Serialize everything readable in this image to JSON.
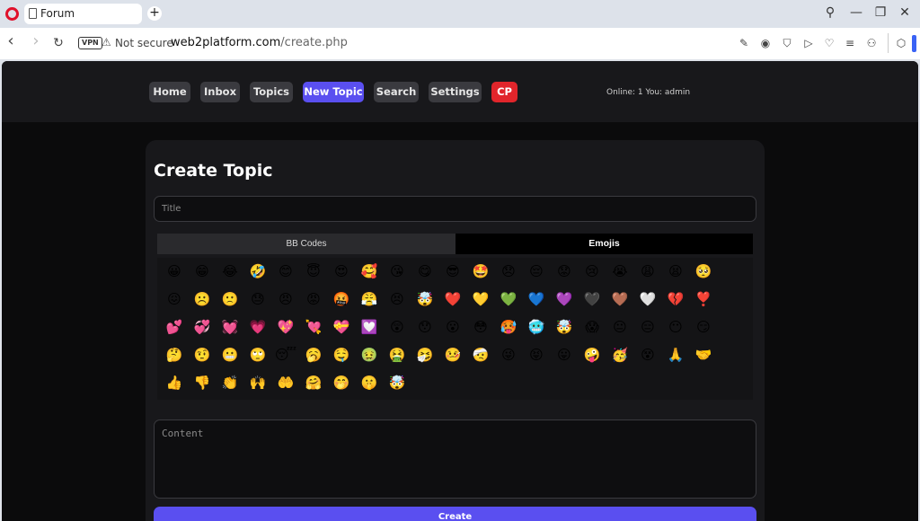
{
  "browser": {
    "tab_title": "Forum",
    "new_tab": "+",
    "controls": {
      "search": "⚲",
      "minimize": "—",
      "restore": "❐",
      "close": "✕"
    },
    "nav": {
      "back": "‹",
      "forward": "›",
      "reload": "↻"
    },
    "vpn_label": "VPN",
    "security_label": "Not secure",
    "url_host": "web2platform.com",
    "url_path": "/create.php",
    "toolbar_icons": [
      "edit-icon",
      "camera-icon",
      "shield-icon",
      "play-icon",
      "heart-icon",
      "menu-icon",
      "user-icon",
      "cube-icon"
    ]
  },
  "header": {
    "nav": [
      {
        "label": "Home",
        "state": "normal"
      },
      {
        "label": "Inbox",
        "state": "normal"
      },
      {
        "label": "Topics",
        "state": "normal"
      },
      {
        "label": "New Topic",
        "state": "active"
      },
      {
        "label": "Search",
        "state": "normal"
      },
      {
        "label": "Settings",
        "state": "normal"
      },
      {
        "label": "CP",
        "state": "danger"
      }
    ],
    "online_text": "Online: 1 You: admin"
  },
  "form": {
    "heading": "Create Topic",
    "title_placeholder": "Title",
    "tabs": {
      "bbcodes": "BB Codes",
      "emojis": "Emojis"
    },
    "emojis": [
      "😀",
      "😁",
      "😂",
      "🤣",
      "😊",
      "😇",
      "😍",
      "🥰",
      "😘",
      "😋",
      "😎",
      "🤩",
      "😞",
      "😔",
      "😟",
      "😢",
      "😭",
      "😩",
      "😫",
      "🥺",
      "😖",
      "☹️",
      "🙁",
      "😓",
      "😠",
      "😡",
      "🤬",
      "😤",
      "😣",
      "🤯",
      "❤️",
      "💛",
      "💚",
      "💙",
      "💜",
      "🖤",
      "🤎",
      "🤍",
      "💔",
      "❣️",
      "💕",
      "💞",
      "💓",
      "💗",
      "💖",
      "💘",
      "💝",
      "💟",
      "😲",
      "😯",
      "😮",
      "😳",
      "🥵",
      "🥶",
      "🤯",
      "😱",
      "😐",
      "😑",
      "😶",
      "😏",
      "🤔",
      "🤨",
      "😬",
      "🙄",
      "😴",
      "🥱",
      "🤤",
      "🤢",
      "🤮",
      "🤧",
      "🤒",
      "🤕",
      "😜",
      "😝",
      "😛",
      "🤪",
      "🥳",
      "😵",
      "🙏",
      "🤝",
      "👍",
      "👎",
      "👏",
      "🙌",
      "🤲",
      "🤗",
      "🤭",
      "🤫",
      "🤯"
    ],
    "content_placeholder": "Content",
    "submit_label": "Create"
  }
}
